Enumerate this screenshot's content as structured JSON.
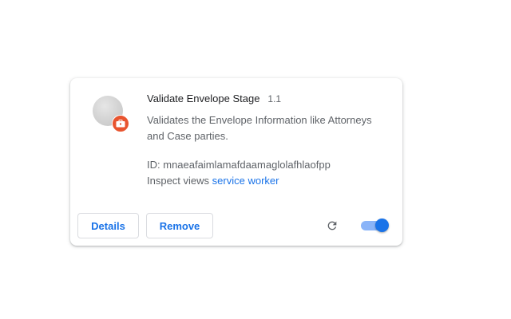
{
  "extension": {
    "name": "Validate Envelope Stage",
    "version": "1.1",
    "description": "Validates the Envelope Information like Attorneys and Case parties.",
    "id_label": "ID:",
    "id_value": "mnaeafaimlamafdaamaglolafhlaofpp",
    "inspect_label": "Inspect views",
    "inspect_link": "service worker",
    "enabled": true,
    "icon": "extension-icon",
    "badge_icon": "policy-badge-icon"
  },
  "actions": {
    "details_label": "Details",
    "remove_label": "Remove",
    "reload_icon": "reload-icon"
  },
  "colors": {
    "accent": "#1a73e8",
    "badge": "#e8542f",
    "text_primary": "#202124",
    "text_secondary": "#5f6368"
  }
}
